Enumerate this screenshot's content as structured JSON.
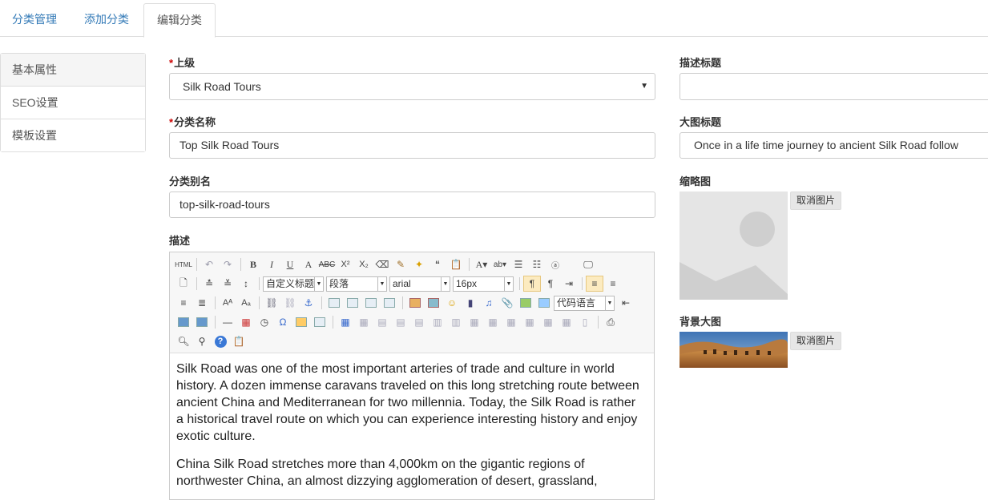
{
  "tabs": [
    {
      "label": "分类管理"
    },
    {
      "label": "添加分类"
    },
    {
      "label": "编辑分类"
    }
  ],
  "side_menu": [
    {
      "label": "基本属性"
    },
    {
      "label": "SEO设置"
    },
    {
      "label": "模板设置"
    }
  ],
  "form": {
    "parent": {
      "label": "上级",
      "required_mark": "*",
      "value": "Silk Road Tours"
    },
    "name": {
      "label": "分类名称",
      "required_mark": "*",
      "value": "Top Silk Road Tours"
    },
    "alias": {
      "label": "分类别名",
      "value": "top-silk-road-tours"
    },
    "description": {
      "label": "描述"
    },
    "desc_title": {
      "label": "描述标题",
      "value": ""
    },
    "banner_title": {
      "label": "大图标题",
      "value": "Once in a life time journey to ancient Silk Road  follow"
    },
    "thumbnail": {
      "label": "缩略图",
      "cancel_label": "取消图片"
    },
    "background": {
      "label": "背景大图",
      "cancel_label": "取消图片"
    }
  },
  "editor": {
    "toolbar": {
      "custom_title": "自定义标题",
      "paragraph": "段落",
      "font_family": "arial",
      "font_size": "16px",
      "code_language": "代码语言"
    },
    "paragraphs": [
      "Silk Road was one of the most important arteries of trade and culture in world history. A dozen immense caravans traveled on this long stretching route between ancient China and Mediterranean for two millennia. Today, the Silk Road is rather a historical travel route on which you can experience interesting history and enjoy exotic culture.",
      "China Silk Road stretches more than 4,000km on the gigantic regions of northwester China, an almost dizzying agglomeration of desert, grassland,"
    ]
  },
  "colors": {
    "link": "#337ab7",
    "required": "#cc0000",
    "border": "#cccccc"
  }
}
